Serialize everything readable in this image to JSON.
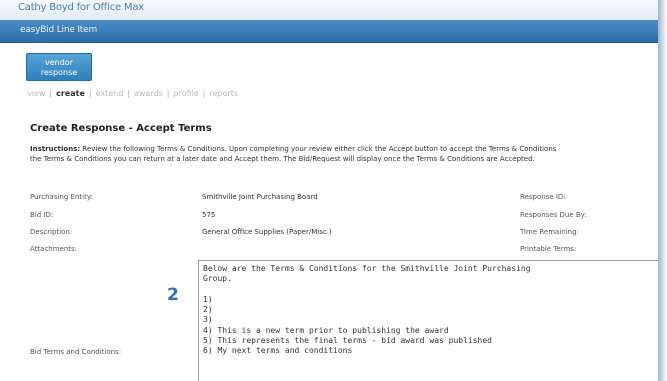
{
  "header": {
    "user_title": "Cathy Boyd for Office Max",
    "page_title": "easyBid Line Item"
  },
  "vendor_button": {
    "label_line1": "vendor",
    "label_line2": "response"
  },
  "nav": {
    "items": [
      "view",
      "create",
      "extend",
      "awards",
      "profile",
      "reports"
    ],
    "active": "create"
  },
  "form": {
    "heading": "Create Response - Accept Terms",
    "instructions_label": "Instructions:",
    "instructions_line1": " Review the following Terms & Conditions. Upon completing your review either click the Accept button to accept the Terms & Conditions",
    "instructions_line2": "the Terms & Conditions you can return at a later date and Accept them. The Bid/Request will display once the Terms & Conditions are Accepted.",
    "fields": [
      {
        "label": "Purchasing Entity:",
        "value": "Smithville Joint Purchasing Board",
        "right_label": "Response ID:"
      },
      {
        "label": "Bid ID:",
        "value": "575",
        "right_label": "Responses Due By:"
      },
      {
        "label": "Description:",
        "value": "General Office Supplies (Paper/Misc.)",
        "right_label": "Time Remaining:"
      },
      {
        "label": "Attachments:",
        "value": "",
        "right_label": "Printable Terms:"
      }
    ],
    "terms_label": "Bid Terms and Conditions:",
    "terms_text": "Below are the Terms & Conditions for the Smithville Joint Purchasing\nGroup.\n\n1)\n2)\n3)\n4) This is a new term prior to publishing the award\n5) This represents the final terms - bid award was published\n6) My next terms and conditions"
  },
  "annotation": {
    "step_number": "2"
  },
  "colors": {
    "accent": "#2f7fba",
    "titlebar": "#2b6ea8",
    "marker": "#2f6fb5"
  }
}
